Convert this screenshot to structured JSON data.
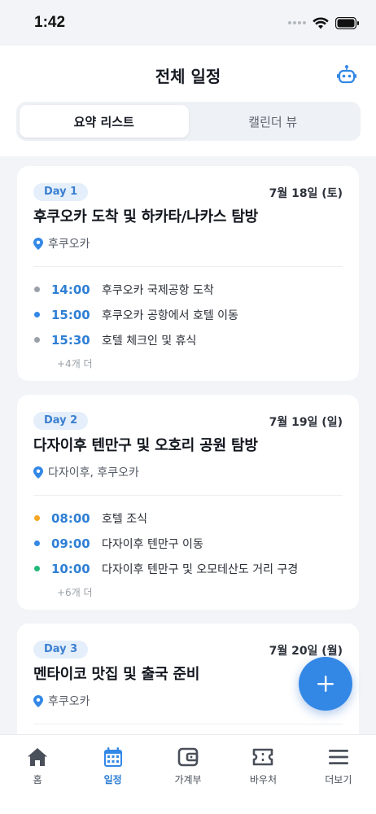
{
  "status_bar": {
    "time": "1:42"
  },
  "header": {
    "title": "전체 일정",
    "bot_icon": "robot-icon",
    "segments": [
      {
        "label": "요약 리스트",
        "active": true
      },
      {
        "label": "캘린더 뷰",
        "active": false
      }
    ]
  },
  "days": [
    {
      "badge": "Day 1",
      "date": "7월 18일 (토)",
      "title": "후쿠오카 도착 및 하카타/나카스 탐방",
      "location": "후쿠오카",
      "events": [
        {
          "time": "14:00",
          "title": "후쿠오카 국제공항 도착",
          "dot_color": "#9AA0A8"
        },
        {
          "time": "15:00",
          "title": "후쿠오카 공항에서 호텔 이동",
          "dot_color": "#3388E6"
        },
        {
          "time": "15:30",
          "title": "호텔 체크인 및 휴식",
          "dot_color": "#9AA0A8"
        }
      ],
      "more": "+4개 더"
    },
    {
      "badge": "Day 2",
      "date": "7월 19일 (일)",
      "title": "다자이후 텐만구 및 오호리 공원 탐방",
      "location": "다자이후, 후쿠오카",
      "events": [
        {
          "time": "08:00",
          "title": "호텔 조식",
          "dot_color": "#F5A623"
        },
        {
          "time": "09:00",
          "title": "다자이후 텐만구 이동",
          "dot_color": "#3388E6"
        },
        {
          "time": "10:00",
          "title": "다자이후 텐만구 및 오모테산도 거리 구경",
          "dot_color": "#22B87A"
        }
      ],
      "more": "+6개 더"
    },
    {
      "badge": "Day 3",
      "date": "7월 20일 (월)",
      "title": "멘타이코 맛집 및 출국 준비",
      "location": "후쿠오카"
    }
  ],
  "fab": {
    "icon": "plus-icon"
  },
  "tabbar": [
    {
      "label": "홈",
      "icon": "home-icon",
      "active": false
    },
    {
      "label": "일정",
      "icon": "calendar-icon",
      "active": true
    },
    {
      "label": "가계부",
      "icon": "wallet-icon",
      "active": false
    },
    {
      "label": "바우처",
      "icon": "ticket-icon",
      "active": false
    },
    {
      "label": "더보기",
      "icon": "menu-icon",
      "active": false
    }
  ],
  "colors": {
    "accent": "#3388E6",
    "background": "#F2F4F7",
    "badge_bg": "#E4EFFB"
  }
}
